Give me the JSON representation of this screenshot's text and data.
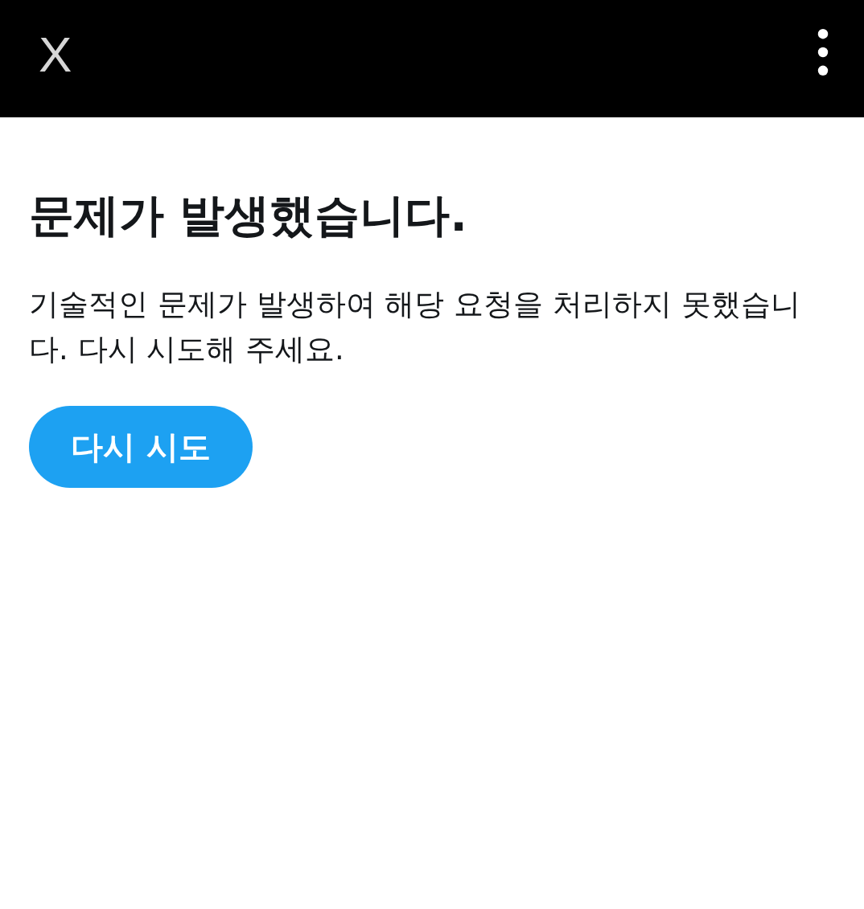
{
  "top_bar": {
    "close_button": "X"
  },
  "error": {
    "title": "문제가 발생했습니다.",
    "message": "기술적인 문제가 발생하여 해당 요청을 처리하지 못했습니다. 다시 시도해 주세요.",
    "retry_button": "다시 시도"
  }
}
